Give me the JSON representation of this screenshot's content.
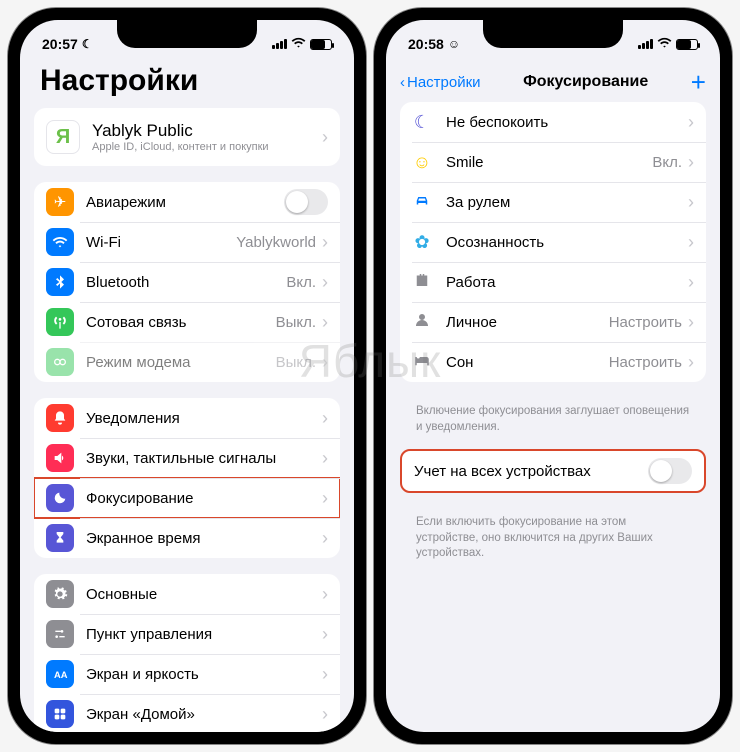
{
  "watermark": "Яблык",
  "left": {
    "status": {
      "time": "20:57",
      "indicator": "moon"
    },
    "title": "Настройки",
    "profile": {
      "initial": "Я",
      "name": "Yablyk Public",
      "subtitle": "Apple ID, iCloud, контент и покупки"
    },
    "group1": [
      {
        "label": "Авиарежим",
        "icon": "airplane",
        "color": "#ff9500",
        "toggle": true,
        "toggle_on": false
      },
      {
        "label": "Wi-Fi",
        "icon": "wifi",
        "color": "#007aff",
        "value": "Yablykworld"
      },
      {
        "label": "Bluetooth",
        "icon": "bluetooth",
        "color": "#007aff",
        "value": "Вкл."
      },
      {
        "label": "Сотовая связь",
        "icon": "antenna",
        "color": "#34c759",
        "value": "Выкл."
      },
      {
        "label": "Режим модема",
        "icon": "hotspot",
        "color": "#34c759",
        "value": "Выкл.",
        "dimmed": true
      }
    ],
    "group2": [
      {
        "label": "Уведомления",
        "icon": "bell",
        "color": "#ff3b30"
      },
      {
        "label": "Звуки, тактильные сигналы",
        "icon": "speaker",
        "color": "#ff2d55"
      },
      {
        "label": "Фокусирование",
        "icon": "moon",
        "color": "#5856d6",
        "highlight": true
      },
      {
        "label": "Экранное время",
        "icon": "hourglass",
        "color": "#5856d6"
      }
    ],
    "group3": [
      {
        "label": "Основные",
        "icon": "gear",
        "color": "#8e8e93"
      },
      {
        "label": "Пункт управления",
        "icon": "sliders",
        "color": "#8e8e93"
      },
      {
        "label": "Экран и яркость",
        "icon": "textsize",
        "color": "#007aff"
      },
      {
        "label": "Экран «Домой»",
        "icon": "grid",
        "color": "#3355dd"
      }
    ]
  },
  "right": {
    "status": {
      "time": "20:58",
      "indicator": "focus"
    },
    "back": "Настройки",
    "title": "Фокусирование",
    "modes": [
      {
        "label": "Не беспокоить",
        "glyph": "moon",
        "color": "purple"
      },
      {
        "label": "Smile",
        "glyph": "smile",
        "color": "yellow",
        "value": "Вкл."
      },
      {
        "label": "За рулем",
        "glyph": "car",
        "color": "blue"
      },
      {
        "label": "Осознанность",
        "glyph": "flower",
        "color": "teal"
      },
      {
        "label": "Работа",
        "glyph": "briefcase",
        "color": "gray"
      },
      {
        "label": "Личное",
        "glyph": "person",
        "color": "gray",
        "value": "Настроить"
      },
      {
        "label": "Сон",
        "glyph": "bed",
        "color": "gray",
        "value": "Настроить"
      }
    ],
    "footer1": "Включение фокусирования заглушает оповещения и уведомления.",
    "share": {
      "label": "Учет на всех устройствах",
      "on": false
    },
    "footer2": "Если включить фокусирование на этом устройстве, оно включится на других Ваших устройствах."
  }
}
